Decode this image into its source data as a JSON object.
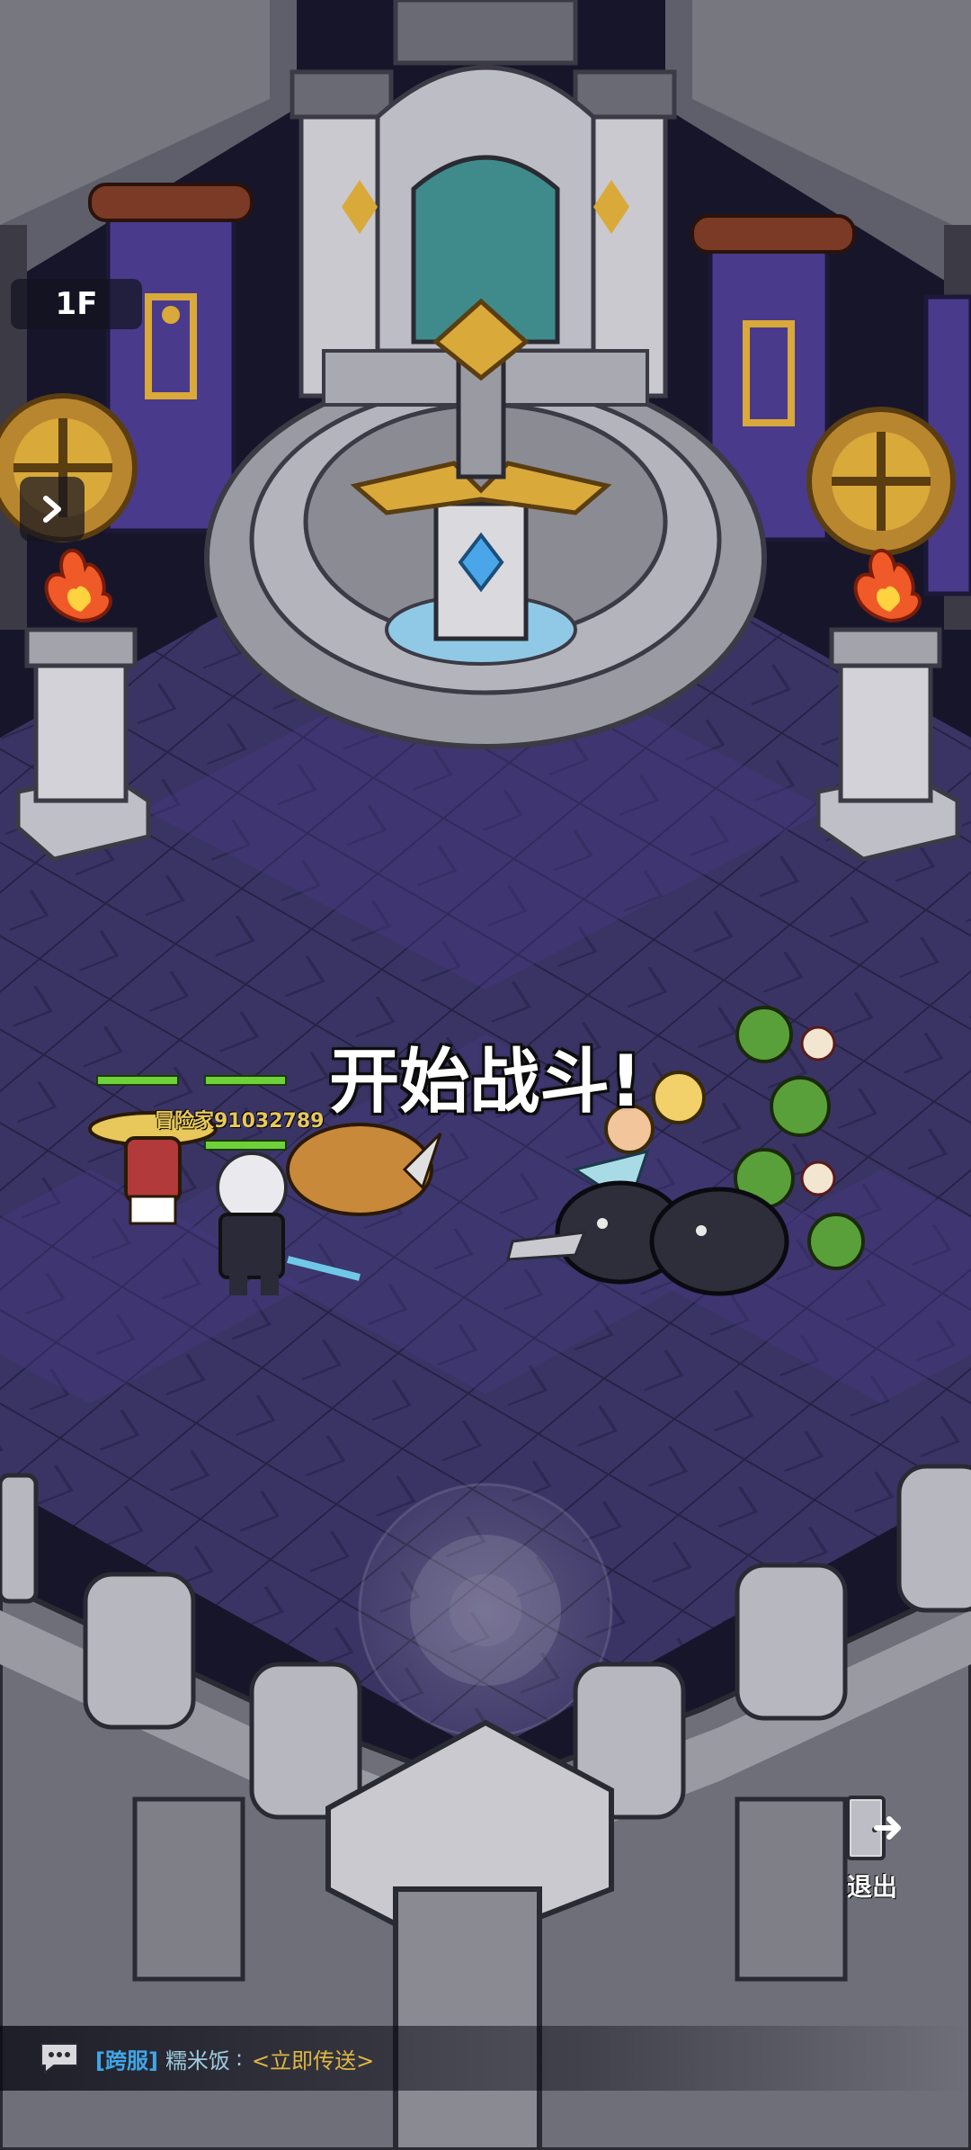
{
  "hud": {
    "floor_label": "1F",
    "battle_banner": "开始战斗!",
    "player_name": "冒险家91032789",
    "exit_label": "退出"
  },
  "chat": {
    "channel": "[跨服]",
    "sender": "糯米饭",
    "separator": ":",
    "message": "<立即传送>"
  },
  "icons": {
    "expand": "chevron-right-icon",
    "exit": "exit-door-icon",
    "chat": "chat-bubble-icon"
  },
  "colors": {
    "floor_tile": "#3b3566",
    "stone": "#8e8e96",
    "banner": "#4a3a8c",
    "gold": "#d9a93a",
    "health": "#6fd13a"
  }
}
